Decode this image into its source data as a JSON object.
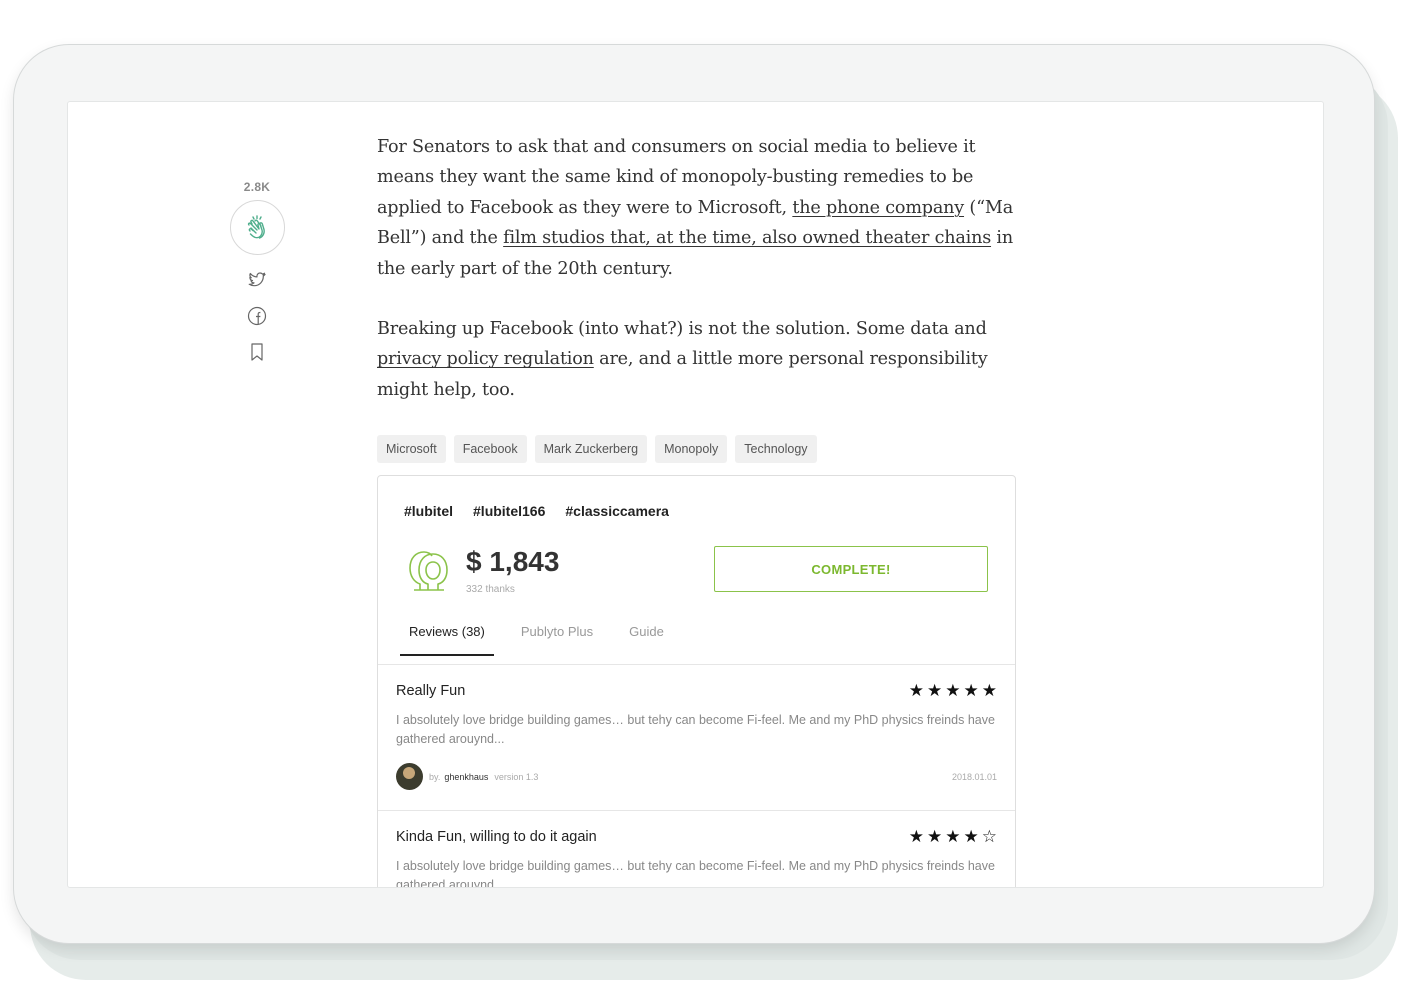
{
  "share_rail": {
    "clap_count": "2.8K",
    "icons": [
      "clap-icon",
      "twitter-icon",
      "facebook-icon",
      "bookmark-icon"
    ]
  },
  "article": {
    "p1_a": "For Senators to ask that and consumers on social media to believe it means they want the same kind of monopoly-busting remedies to be applied to Facebook as they were to Microsoft, ",
    "p1_link1": "the phone company",
    "p1_b": " (“Ma Bell”) and the ",
    "p1_link2": "film studios that, at the time, also owned theater chains",
    "p1_c": " in the early part of the 20th century.",
    "p2_a": "Breaking up Facebook (into what?) is not the solution. Some data and ",
    "p2_link": "privacy policy regulation",
    "p2_b": " are, and a little more personal responsibility might help, too."
  },
  "tags": [
    "Microsoft",
    "Facebook",
    "Mark Zuckerberg",
    "Monopoly",
    "Technology"
  ],
  "card": {
    "hashtags": [
      "#lubitel",
      "#lubitel166",
      "#classiccamera"
    ],
    "amount": "$ 1,843",
    "thanks": "332 thanks",
    "complete_label": "COMPLETE!",
    "accent_color": "#8bc34a",
    "tabs": [
      "Reviews (38)",
      "Publyto Plus",
      "Guide"
    ],
    "active_tab": "Reviews (38)"
  },
  "reviews": [
    {
      "title": "Really Fun",
      "rating": 5,
      "body": "I absolutely love bridge building games… but tehy can become Fi-feel. Me and my PhD physics freinds have gathered arouynd...",
      "by": "by.",
      "user": "ghenkhaus",
      "version": "version 1.3",
      "date": "2018.01.01"
    },
    {
      "title": "Kinda Fun, willing to do it again",
      "rating": 4,
      "body": "I absolutely love bridge building games… but tehy can become Fi-feel. Me and my PhD physics freinds have gathered arouynd..."
    }
  ]
}
